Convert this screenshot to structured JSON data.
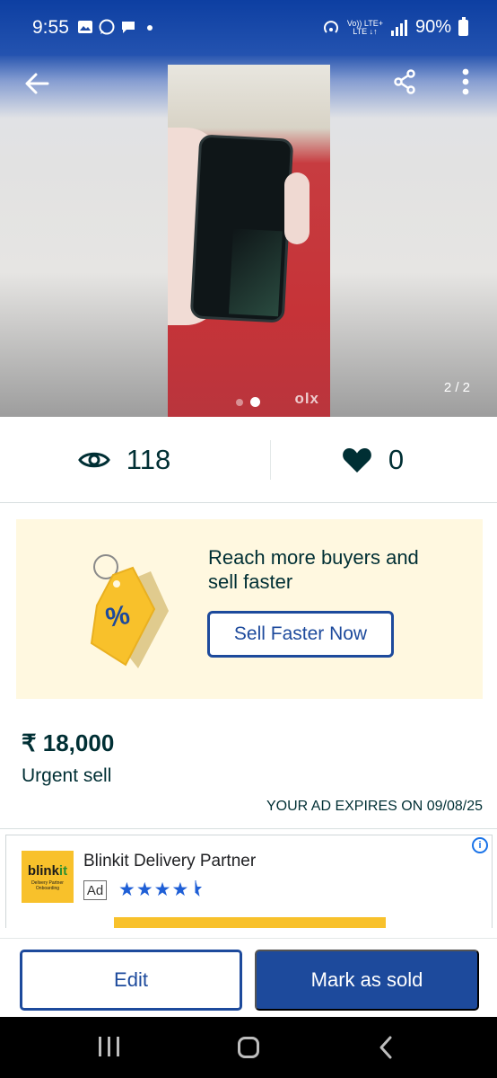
{
  "status_bar": {
    "time": "9:55",
    "net_label_top": "Vo)) LTE+",
    "net_label_bottom": "LTE ↓↑",
    "battery": "90%"
  },
  "hero": {
    "image_counter": "2 / 2",
    "watermark": "olx",
    "current_slide": 2,
    "total_slides": 2
  },
  "stats": {
    "views": "118",
    "likes": "0"
  },
  "promo": {
    "headline": "Reach more buyers and sell faster",
    "button_label": "Sell Faster Now",
    "tag_symbol": "%"
  },
  "listing": {
    "price": "₹ 18,000",
    "title": "Urgent sell",
    "expiry": "YOUR AD EXPIRES ON 09/08/25"
  },
  "ad": {
    "logo_text_a": "blink",
    "logo_text_b": "it",
    "logo_subtext": "Delivery Partner Onboarding",
    "title": "Blinkit Delivery Partner",
    "badge": "Ad",
    "stars": "★★★★",
    "rating": 4.5,
    "info_icon": "i"
  },
  "actions": {
    "edit_label": "Edit",
    "mark_sold_label": "Mark as sold"
  },
  "colors": {
    "brand_blue": "#1d4a9c",
    "text_dark": "#002f34",
    "promo_bg": "#fff8e0",
    "tag_yellow": "#f8c12b"
  }
}
